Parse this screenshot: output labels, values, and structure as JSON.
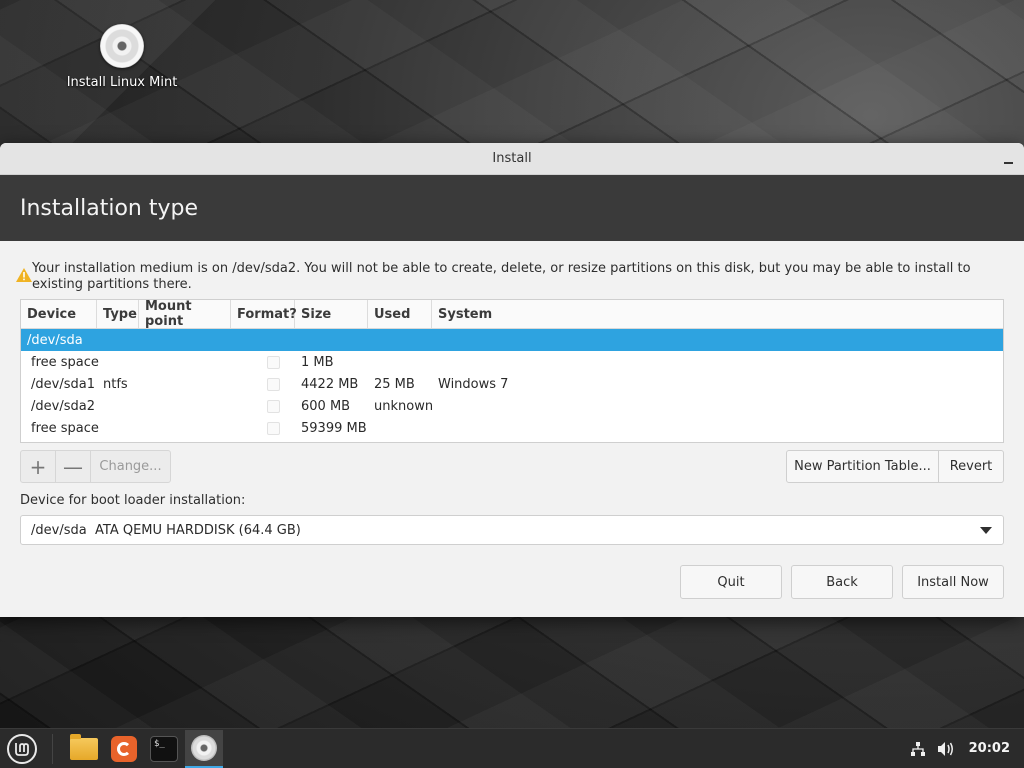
{
  "desktop": {
    "icon_label": "Install Linux Mint"
  },
  "window": {
    "title": "Install",
    "header_title": "Installation type",
    "warning": "Your installation medium is on /dev/sda2. You will not be able to create, delete, or resize partitions on this disk, but you may be able to install to existing partitions there."
  },
  "table": {
    "columns": [
      "Device",
      "Type",
      "Mount point",
      "Format?",
      "Size",
      "Used",
      "System"
    ],
    "rows": [
      {
        "device": "/dev/sda",
        "type": "",
        "mount": "",
        "format": false,
        "size": "",
        "used": "",
        "system": "",
        "selected": true
      },
      {
        "device": "free space",
        "type": "",
        "mount": "",
        "format": false,
        "size": "1 MB",
        "used": "",
        "system": ""
      },
      {
        "device": "/dev/sda1",
        "type": "ntfs",
        "mount": "",
        "format": false,
        "size": "4422 MB",
        "used": "25 MB",
        "system": "Windows 7"
      },
      {
        "device": "/dev/sda2",
        "type": "",
        "mount": "",
        "format": false,
        "size": "600 MB",
        "used": "unknown",
        "system": ""
      },
      {
        "device": "free space",
        "type": "",
        "mount": "",
        "format": false,
        "size": "59399 MB",
        "used": "",
        "system": ""
      }
    ]
  },
  "toolbar": {
    "add_label": "+",
    "remove_label": "—",
    "change_label": "Change...",
    "new_partition_table_label": "New Partition Table...",
    "revert_label": "Revert"
  },
  "bootloader": {
    "label": "Device for boot loader installation:",
    "device": "/dev/sda",
    "description": "ATA QEMU HARDDISK (64.4 GB)"
  },
  "actions": {
    "quit_label": "Quit",
    "back_label": "Back",
    "install_label": "Install Now"
  },
  "taskbar": {
    "terminal_glyph": "$_",
    "clock": "20:02",
    "accent_color": "#3fa8e6"
  },
  "colors": {
    "selection": "#2ea3e0",
    "header_bg": "#3a3a3a"
  }
}
